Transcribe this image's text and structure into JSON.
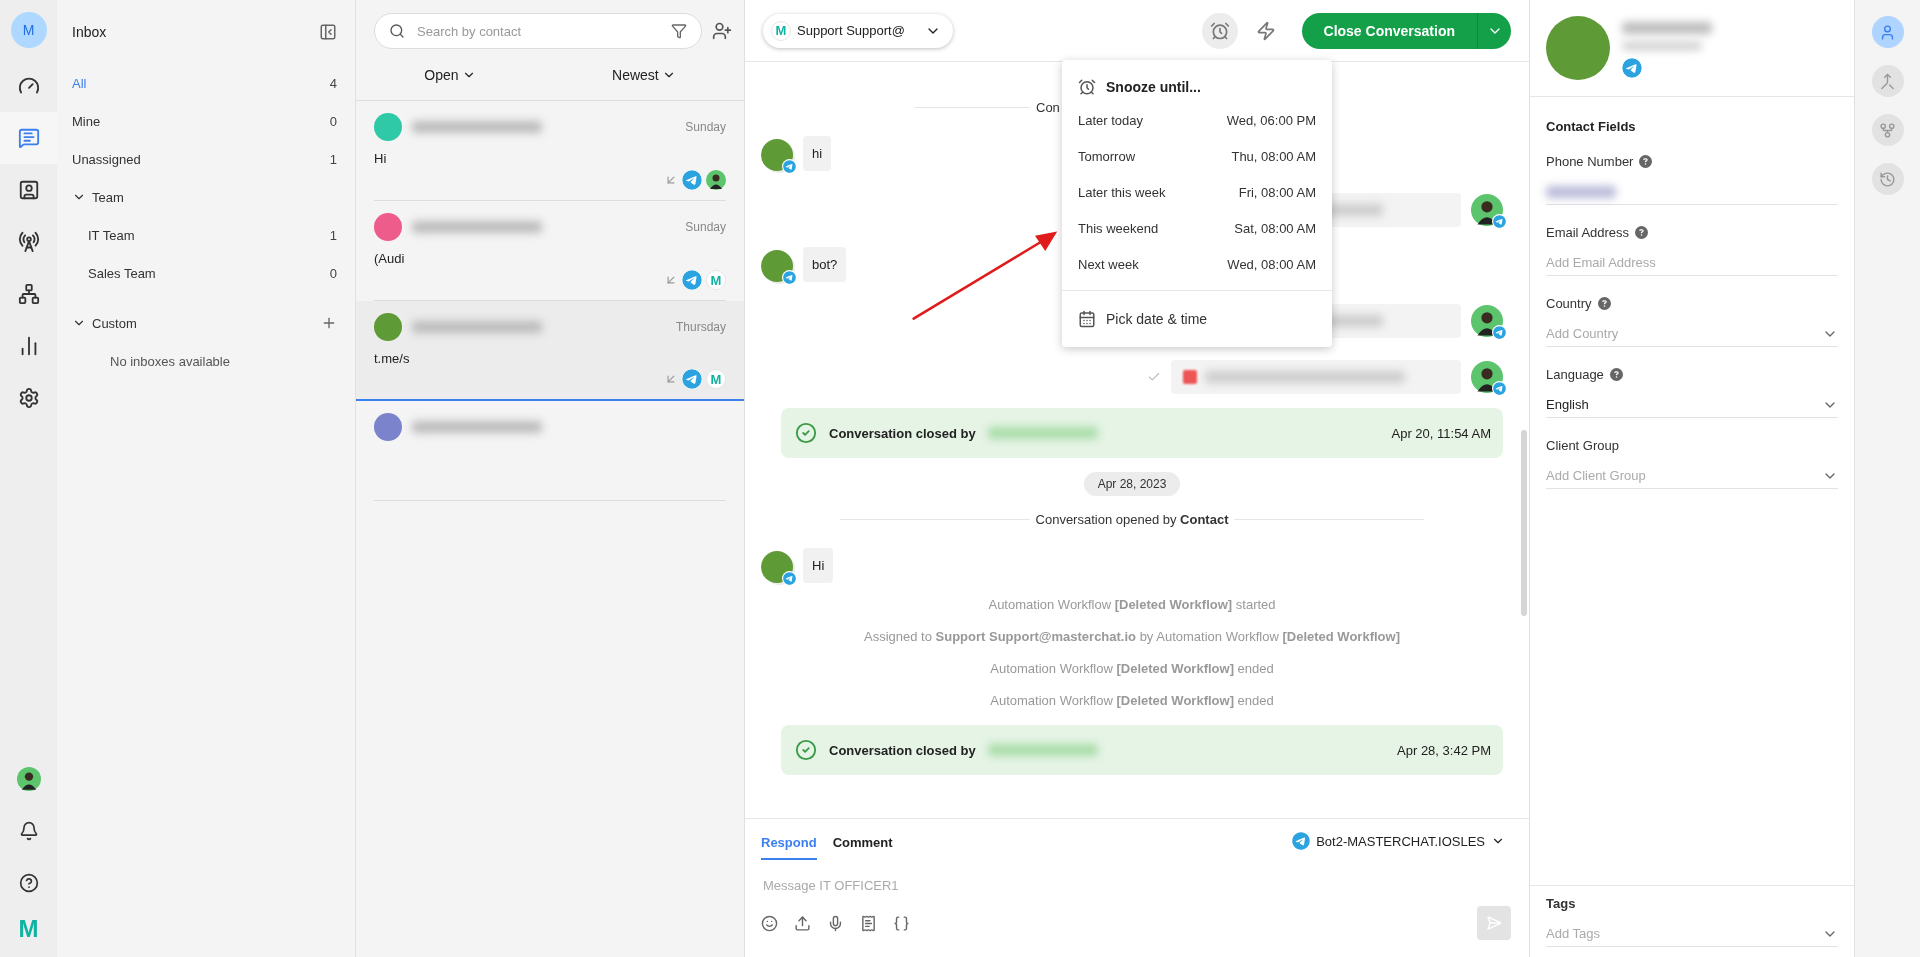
{
  "rail": {
    "avatar_initial": "M",
    "items": [
      {
        "kind": "gauge",
        "selected": false
      },
      {
        "kind": "chat",
        "selected": true
      },
      {
        "kind": "contact",
        "selected": false
      },
      {
        "kind": "broadcast",
        "selected": false
      },
      {
        "kind": "network",
        "selected": false
      },
      {
        "kind": "chart",
        "selected": false
      },
      {
        "kind": "settings",
        "selected": false
      }
    ],
    "bottom": [
      {
        "kind": "profile"
      },
      {
        "kind": "bell"
      },
      {
        "kind": "help"
      }
    ],
    "logo_text": "M"
  },
  "inbox": {
    "title": "Inbox",
    "items": [
      {
        "label": "All",
        "count": "4",
        "selected": true
      },
      {
        "label": "Mine",
        "count": "0",
        "selected": false
      },
      {
        "label": "Unassigned",
        "count": "1",
        "selected": false
      }
    ],
    "groups": [
      {
        "label": "Team",
        "expanded": true,
        "add": false,
        "children": [
          {
            "label": "IT Team",
            "count": "1",
            "selected": false
          },
          {
            "label": "Sales Team",
            "count": "0",
            "selected": false
          }
        ]
      },
      {
        "label": "Custom",
        "expanded": true,
        "add": true,
        "empty_text": "No inboxes available"
      }
    ]
  },
  "conversations": {
    "search": {
      "placeholder": "Search by contact"
    },
    "status_filter": "Open",
    "sort": "Newest",
    "items": [
      {
        "color": "#2fc9a8",
        "time": "Sunday",
        "preview": "Hi",
        "selected": false,
        "assignee": {
          "kind": "photo"
        }
      },
      {
        "color": "#ee5c8c",
        "time": "Sunday",
        "preview": "(Audi",
        "selected": false,
        "assignee": {
          "kind": "logo",
          "text": "M"
        }
      },
      {
        "color": "#5e9a35",
        "time": "Thursday",
        "preview": "t.me/s",
        "selected": true,
        "assignee": {
          "kind": "logo",
          "text": "M"
        }
      },
      {
        "color": "#7b83cc",
        "selected": false
      }
    ]
  },
  "chat": {
    "assignee": {
      "logo_text": "M",
      "label": "Support Support@"
    },
    "snooze_active": true,
    "close_button": "Close Conversation",
    "messages": [
      {
        "kind": "system",
        "text": "Con"
      },
      {
        "kind": "incoming",
        "text": "hi"
      },
      {
        "kind": "outgoing",
        "file": false
      },
      {
        "kind": "incoming",
        "text": "bot?"
      },
      {
        "kind": "outgoing",
        "file": false
      },
      {
        "kind": "outgoing",
        "file": true
      },
      {
        "kind": "closed",
        "text": "Conversation closed by",
        "time": "Apr 20, 11:54 AM"
      },
      {
        "kind": "date",
        "text": "Apr 28, 2023"
      },
      {
        "kind": "system",
        "text": "Conversation opened by **Contact**"
      },
      {
        "kind": "incoming",
        "text": "Hi"
      },
      {
        "kind": "activity",
        "text": "Automation Workflow **[Deleted Workflow]** started"
      },
      {
        "kind": "activity",
        "text": "Assigned to **Support Support@masterchat.io** by Automation Workflow **[Deleted Workflow]**"
      },
      {
        "kind": "activity",
        "text": "Automation Workflow **[Deleted Workflow]** ended"
      },
      {
        "kind": "activity",
        "text": "Automation Workflow **[Deleted Workflow]** ended"
      },
      {
        "kind": "closed",
        "text": "Conversation closed by",
        "time": "Apr 28, 3:42 PM"
      }
    ],
    "composer": {
      "tabs": [
        {
          "label": "Respond",
          "selected": true
        },
        {
          "label": "Comment",
          "selected": false
        }
      ],
      "channel": "Bot2-MASTERCHAT.IOSLES",
      "placeholder": "Message IT OFFICER1",
      "tools": [
        {
          "kind": "emoji"
        },
        {
          "kind": "upload"
        },
        {
          "kind": "mic"
        },
        {
          "kind": "template"
        },
        {
          "kind": "variable"
        }
      ],
      "send_disabled": true
    },
    "snooze_menu": {
      "title": "Snooze until...",
      "options": [
        {
          "label": "Later today",
          "time": "Wed, 06:00 PM"
        },
        {
          "label": "Tomorrow",
          "time": "Thu, 08:00 AM"
        },
        {
          "label": "Later this week",
          "time": "Fri, 08:00 AM"
        },
        {
          "label": "This weekend",
          "time": "Sat, 08:00 AM"
        },
        {
          "label": "Next week",
          "time": "Wed, 08:00 AM"
        }
      ],
      "custom": "Pick date & time"
    }
  },
  "contact": {
    "color": "#5e9a35",
    "section_title": "Contact Fields",
    "fields": [
      {
        "label": "Phone Number",
        "help": true,
        "kind": "phone"
      },
      {
        "label": "Email Address",
        "help": true,
        "kind": "text",
        "placeholder": "Add Email Address"
      },
      {
        "label": "Country",
        "help": true,
        "kind": "select",
        "placeholder": "Add Country"
      },
      {
        "label": "Language",
        "help": true,
        "kind": "select",
        "value": "English"
      },
      {
        "label": "Client Group",
        "help": false,
        "kind": "select",
        "placeholder": "Add Client Group"
      }
    ],
    "tags": {
      "label": "Tags",
      "placeholder": "Add Tags"
    }
  },
  "side_rail": [
    {
      "kind": "profile",
      "selected": true
    },
    {
      "kind": "merge",
      "selected": false
    },
    {
      "kind": "nodes",
      "selected": false
    },
    {
      "kind": "history",
      "selected": false
    }
  ]
}
